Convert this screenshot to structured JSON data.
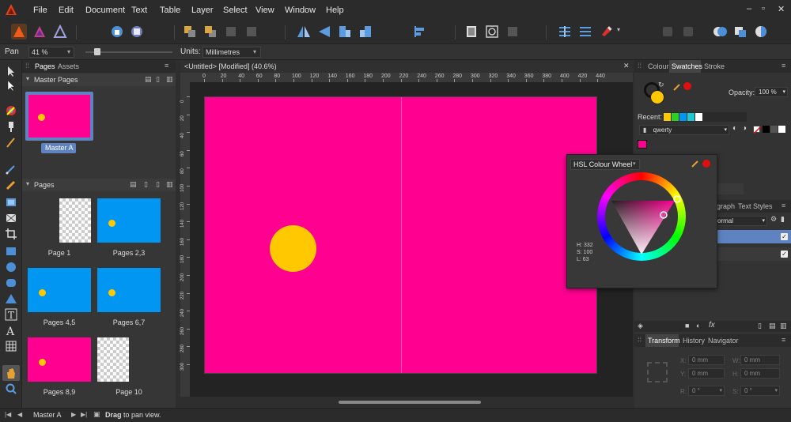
{
  "menubar": {
    "items": [
      "File",
      "Edit",
      "Document",
      "Text",
      "Table",
      "Layer",
      "Select",
      "View",
      "Window",
      "Help"
    ],
    "window_controls": [
      "–",
      "▫",
      "✕"
    ]
  },
  "context": {
    "tool_name": "Pan",
    "zoom_value": "41 %",
    "units_label": "Units:",
    "units_value": "Millimetres"
  },
  "left_panel": {
    "tabs": [
      "Pages",
      "Assets"
    ],
    "master_section": "Master Pages",
    "master_label": "Master A",
    "pages_section": "Pages",
    "pages": [
      "Page 1",
      "Pages 2,3",
      "Pages 4,5",
      "Pages 6,7",
      "Pages 8,9",
      "Page 10"
    ]
  },
  "document": {
    "tab_title": "<Untitled> [Modified] (40.6%)",
    "ruler_h": [
      "0",
      "20",
      "40",
      "60",
      "80",
      "100",
      "120",
      "140",
      "160",
      "180",
      "200",
      "220",
      "240",
      "260",
      "280",
      "300",
      "320",
      "340",
      "360",
      "380",
      "400",
      "420",
      "440"
    ],
    "ruler_v": [
      "0",
      "20",
      "40",
      "60",
      "80",
      "100",
      "120",
      "140",
      "160",
      "180",
      "200",
      "220",
      "240",
      "260",
      "280",
      "300"
    ]
  },
  "colors": {
    "magenta": "#ff0090",
    "blue": "#0096f2",
    "yellow": "#ffc800",
    "accent_red": "#e01010"
  },
  "right_panel": {
    "tabs": [
      "Colour",
      "Swatches",
      "Stroke"
    ],
    "opacity_label": "Opacity:",
    "opacity_value": "100 %",
    "recent_label": "Recent:",
    "palette_name": "qwerty",
    "style_tabs": [
      "graph",
      "Text Styles"
    ],
    "style_value": "ormal",
    "transform_tabs": [
      "Transform",
      "History",
      "Navigator"
    ],
    "transform_fields": {
      "x_label": "X:",
      "x": "0 mm",
      "w_label": "W:",
      "w": "0 mm",
      "y_label": "Y:",
      "y": "0 mm",
      "h_label": "H:",
      "h": "0 mm",
      "r_label": "R:",
      "r": "0 °",
      "s_label": "S:",
      "s": "0 °"
    }
  },
  "popup": {
    "mode": "HSL Colour Wheel",
    "h": "H: 332",
    "s": "S: 100",
    "l": "L: 63"
  },
  "statusbar": {
    "page": "Master A",
    "hint_bold": "Drag",
    "hint_rest": " to pan view."
  }
}
